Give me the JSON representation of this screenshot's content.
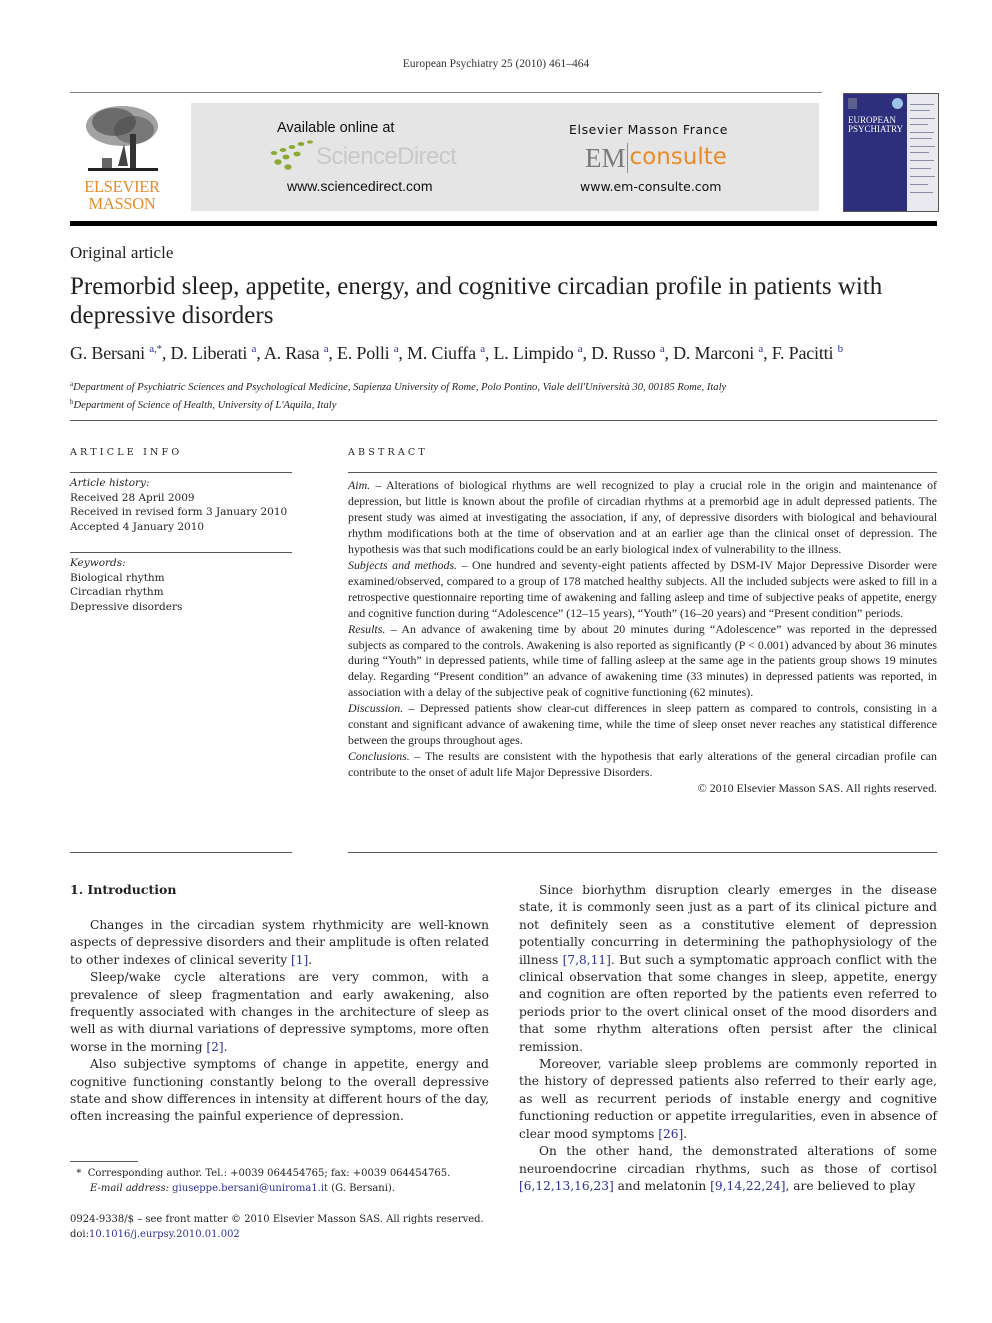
{
  "header": {
    "journal_reference": "European Psychiatry 25 (2010) 461–464",
    "publisher_logo": {
      "line1": "ELSEVIER",
      "line2": "MASSON",
      "color": "#e98b2a"
    },
    "sciencedirect": {
      "available": "Available online at",
      "brand": "ScienceDirect",
      "url": "www.sciencedirect.com"
    },
    "emconsulte": {
      "title": "Elsevier Masson France",
      "em": "EM",
      "consulte": "consulte",
      "url": "www.em-consulte.com",
      "accent": "#e98b2a"
    },
    "cover": {
      "line1": "EUROPEAN",
      "line2": "PSYCHIATRY",
      "color": "#2d2f7d"
    }
  },
  "article": {
    "type": "Original article",
    "title": "Premorbid sleep, appetite, energy, and cognitive circadian profile in patients with depressive disorders",
    "authors": [
      {
        "name": "G. Bersani",
        "aff": "a,*"
      },
      {
        "name": "D. Liberati",
        "aff": "a"
      },
      {
        "name": "A. Rasa",
        "aff": "a"
      },
      {
        "name": "E. Polli",
        "aff": "a"
      },
      {
        "name": "M. Ciuffa",
        "aff": "a"
      },
      {
        "name": "L. Limpido",
        "aff": "a"
      },
      {
        "name": "D. Russo",
        "aff": "a"
      },
      {
        "name": "D. Marconi",
        "aff": "a"
      },
      {
        "name": "F. Pacitti",
        "aff": "b"
      }
    ],
    "affiliations": [
      {
        "key": "a",
        "text": "Department of Psychiatric Sciences and Psychological Medicine, Sapienza University of Rome, Polo Pontino, Viale dell'Università 30, 00185 Rome, Italy"
      },
      {
        "key": "b",
        "text": "Department of Science of Health, University of L'Aquila, Italy"
      }
    ]
  },
  "article_info": {
    "heading": "ARTICLE INFO",
    "history_label": "Article history:",
    "history": [
      "Received 28 April 2009",
      "Received in revised form 3 January 2010",
      "Accepted 4 January 2010"
    ],
    "keywords_label": "Keywords:",
    "keywords": [
      "Biological rhythm",
      "Circadian rhythm",
      "Depressive disorders"
    ]
  },
  "abstract": {
    "heading": "ABSTRACT",
    "sections": [
      {
        "label": "Aim.",
        "text": " – Alterations of biological rhythms are well recognized to play a crucial role in the origin and maintenance of depression, but little is known about the profile of circadian rhythms at a premorbid age in adult depressed patients. The present study was aimed at investigating the association, if any, of depressive disorders with biological and behavioural rhythm modifications both at the time of observation and at an earlier age than the clinical onset of depression. The hypothesis was that such modifications could be an early biological index of vulnerability to the illness."
      },
      {
        "label": "Subjects and methods.",
        "text": " – One hundred and seventy-eight patients affected by DSM-IV Major Depressive Disorder were examined/observed, compared to a group of 178 matched healthy subjects. All the included subjects were asked to fill in a retrospective questionnaire reporting time of awakening and falling asleep and time of subjective peaks of appetite, energy and cognitive function during “Adolescence” (12–15 years), “Youth” (16–20 years) and “Present condition” periods."
      },
      {
        "label": "Results.",
        "text": " – An advance of awakening time by about 20 minutes during “Adolescence” was reported in the depressed subjects as compared to the controls. Awakening is also reported as significantly (P < 0.001) advanced by about 36 minutes during “Youth” in depressed patients, while time of falling asleep at the same age in the patients group shows 19 minutes delay. Regarding “Present condition” an advance of awakening time (33 minutes) in depressed patients was reported, in association with a delay of the subjective peak of cognitive functioning (62 minutes)."
      },
      {
        "label": "Discussion.",
        "text": " – Depressed patients show clear-cut differences in sleep pattern as compared to controls, consisting in a constant and significant advance of awakening time, while the time of sleep onset never reaches any statistical difference between the groups throughout ages."
      },
      {
        "label": "Conclusions.",
        "text": " – The results are consistent with the hypothesis that early alterations of the general circadian profile can contribute to the onset of adult life Major Depressive Disorders."
      }
    ],
    "copyright": "© 2010 Elsevier Masson SAS. All rights reserved."
  },
  "body": {
    "section_heading": "1.  Introduction",
    "left_paragraphs": [
      {
        "text": "Changes in the circadian system rhythmicity are well-known aspects of depressive disorders and their amplitude is often related to other indexes of clinical severity ",
        "cite": "[1]",
        "after": "."
      },
      {
        "text": "Sleep/wake cycle alterations are very common, with a prevalence of sleep fragmentation and early awakening, also frequently associated with changes in the architecture of sleep as well as with diurnal variations of depressive symptoms, more often worse in the morning ",
        "cite": "[2]",
        "after": "."
      },
      {
        "text": "Also subjective symptoms of change in appetite, energy and cognitive functioning constantly belong to the overall depressive state and show differences in intensity at different hours of the day, often increasing the painful experience of depression.",
        "cite": "",
        "after": ""
      }
    ],
    "right_paragraphs": [
      {
        "text": "Since biorhythm disruption clearly emerges in the disease state, it is commonly seen just as a part of its clinical picture and not definitely seen as a constitutive element of depression potentially concurring in determining the pathophysiology of the illness ",
        "cite": "[7,8,11]",
        "after": ". But such a symptomatic approach conflict with the clinical observation that some changes in sleep, appetite, energy and cognition are often reported by the patients even referred to periods prior to the overt clinical onset of the mood disorders and that some rhythm alterations often persist after the clinical remission."
      },
      {
        "text": "Moreover, variable sleep problems are commonly reported in the history of depressed patients also referred to their early age, as well as recurrent periods of instable energy and cognitive functioning reduction or appetite irregularities, even in absence of clear mood symptoms ",
        "cite": "[26]",
        "after": "."
      },
      {
        "text": "On the other hand, the demonstrated alterations of some neuroendocrine circadian rhythms, such as those of cortisol ",
        "cite": "[6,12,13,16,23]",
        "mid": " and melatonin ",
        "cite2": "[9,14,22,24]",
        "after": ", are believed to play"
      }
    ]
  },
  "footnote": {
    "marker": "*",
    "corresponding": "Corresponding author. Tel.: +0039 064454765; fax: +0039 064454765.",
    "email_label": "E-mail address:",
    "email": "giuseppe.bersani@uniroma1.it",
    "email_after": " (G. Bersani).",
    "front_matter": "0924-9338/$ – see front matter © 2010 Elsevier Masson SAS. All rights reserved.",
    "doi_label": "doi:",
    "doi": "10.1016/j.eurpsy.2010.01.002"
  },
  "colors": {
    "link": "#2e3192",
    "logo_orange": "#e98b2a",
    "banner_gray": "#e5e5e5"
  }
}
